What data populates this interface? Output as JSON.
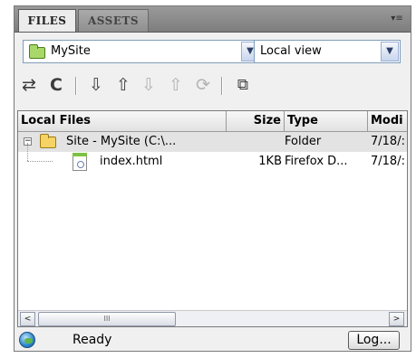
{
  "tabs": [
    {
      "label": "FILES",
      "active": true
    },
    {
      "label": "ASSETS",
      "active": false
    }
  ],
  "panel_menu_icon": "panel-options-menu-icon",
  "site_select": {
    "value": "MySite",
    "icon": "green-folder-icon"
  },
  "view_select": {
    "value": "Local view"
  },
  "toolbar": [
    {
      "name": "connect-icon",
      "glyph": "⇄",
      "enabled": true
    },
    {
      "name": "refresh-icon",
      "glyph": "C",
      "enabled": true
    },
    {
      "name": "get-files-icon",
      "glyph": "⇩",
      "enabled": true
    },
    {
      "name": "put-files-icon",
      "glyph": "⇧",
      "enabled": true
    },
    {
      "name": "check-out-icon",
      "glyph": "⇩",
      "enabled": false
    },
    {
      "name": "check-in-icon",
      "glyph": "⇧",
      "enabled": false
    },
    {
      "name": "synchronize-icon",
      "glyph": "⟳",
      "enabled": false
    },
    {
      "name": "expand-icon",
      "glyph": "⧉",
      "enabled": true
    }
  ],
  "columns": [
    "Local Files",
    "Size",
    "Type",
    "Modi"
  ],
  "rows": [
    {
      "name": "Site - MySite (C:\\...",
      "size": "",
      "type": "Folder",
      "modified": "7/18/:"
    },
    {
      "name": "index.html",
      "size": "1KB",
      "type": "Firefox D...",
      "modified": "7/18/:"
    }
  ],
  "scroll": {
    "left": "<",
    "right": ">",
    "thumb": "III"
  },
  "status": {
    "text": "Ready",
    "log_button": "Log..."
  }
}
